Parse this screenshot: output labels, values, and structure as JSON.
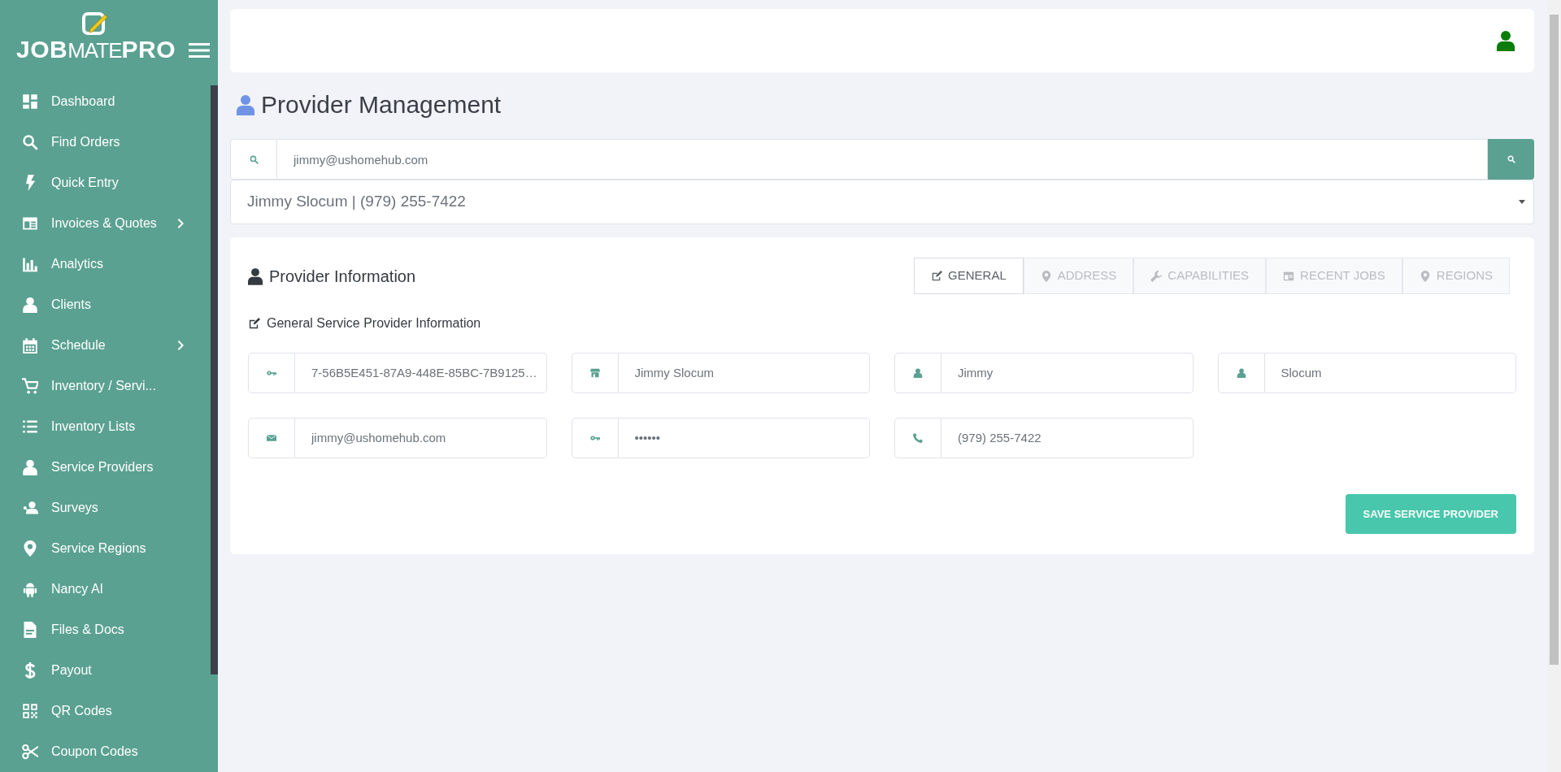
{
  "brand": {
    "part_1": "JOB",
    "part_2": "MATE",
    "part_3": "PRO"
  },
  "sidebar": {
    "items": [
      {
        "label": "Dashboard",
        "kind": "dashboard",
        "has_submenu": false
      },
      {
        "label": "Find Orders",
        "kind": "search",
        "has_submenu": false
      },
      {
        "label": "Quick Entry",
        "kind": "bolt",
        "has_submenu": false
      },
      {
        "label": "Invoices & Quotes",
        "kind": "invoice",
        "has_submenu": true
      },
      {
        "label": "Analytics",
        "kind": "chart",
        "has_submenu": false
      },
      {
        "label": "Clients",
        "kind": "user",
        "has_submenu": false
      },
      {
        "label": "Schedule",
        "kind": "calendar",
        "has_submenu": true
      },
      {
        "label": "Inventory / Servi...",
        "kind": "cart",
        "has_submenu": false
      },
      {
        "label": "Inventory Lists",
        "kind": "list",
        "has_submenu": false
      },
      {
        "label": "Service Providers",
        "kind": "user",
        "has_submenu": false
      },
      {
        "label": "Surveys",
        "kind": "survey",
        "has_submenu": false
      },
      {
        "label": "Service Regions",
        "kind": "pin",
        "has_submenu": false
      },
      {
        "label": "Nancy AI",
        "kind": "robot",
        "has_submenu": false
      },
      {
        "label": "Files & Docs",
        "kind": "file",
        "has_submenu": false
      },
      {
        "label": "Payout",
        "kind": "dollar",
        "has_submenu": false
      },
      {
        "label": "QR Codes",
        "kind": "qr",
        "has_submenu": false
      },
      {
        "label": "Coupon Codes",
        "kind": "scissors",
        "has_submenu": false
      }
    ]
  },
  "page_title": "Provider Management",
  "search": {
    "value": "jimmy@ushomehub.com"
  },
  "provider_select": {
    "value": "Jimmy Slocum | (979) 255-7422"
  },
  "card": {
    "title": "Provider Information",
    "tabs": [
      {
        "label": "GENERAL",
        "kind": "edit",
        "selected": true
      },
      {
        "label": "ADDRESS",
        "kind": "pin",
        "selected": false
      },
      {
        "label": "CAPABILITIES",
        "kind": "wrench",
        "selected": false
      },
      {
        "label": "RECENT JOBS",
        "kind": "jobs",
        "selected": false
      },
      {
        "label": "REGIONS",
        "kind": "pin",
        "selected": false
      }
    ],
    "section_title": "General Service Provider Information",
    "fields": [
      {
        "kind": "key",
        "value": "7-56B5E451-87A9-448E-85BC-7B9125…"
      },
      {
        "kind": "store",
        "value": "Jimmy Slocum"
      },
      {
        "kind": "user",
        "value": "Jimmy"
      },
      {
        "kind": "user",
        "value": "Slocum"
      },
      {
        "kind": "mail",
        "value": "jimmy@ushomehub.com"
      },
      {
        "kind": "key",
        "value": "••••••"
      },
      {
        "kind": "phone",
        "value": "(979) 255-7422"
      }
    ],
    "save_button": "SAVE SERVICE PROVIDER"
  }
}
